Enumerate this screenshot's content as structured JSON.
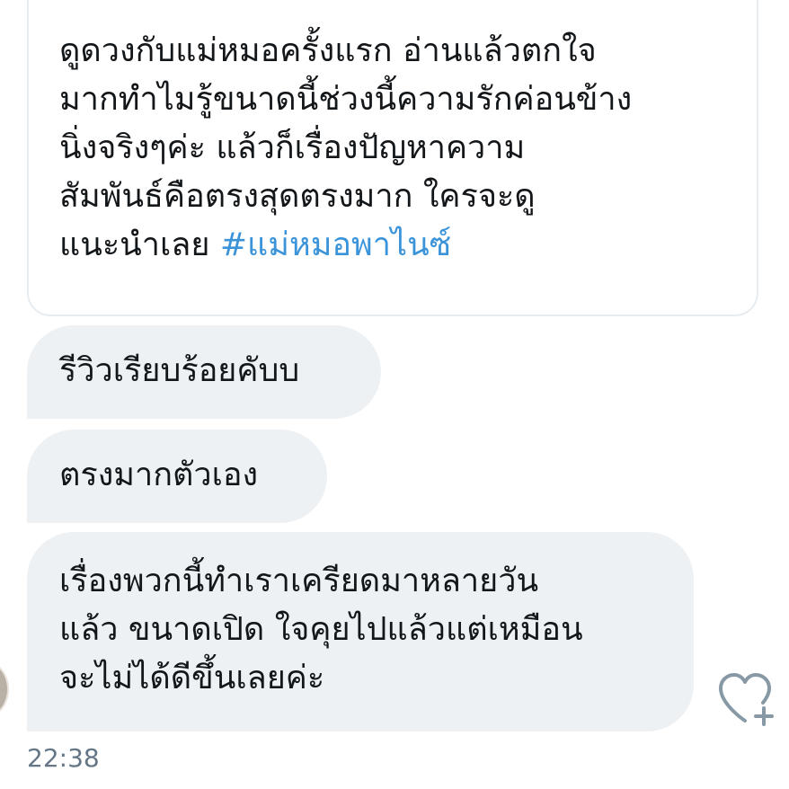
{
  "quoted_message": {
    "text": "ดูดวงกับแม่หมอครั้งแรก อ่านแล้วตกใจ\nมากทำไมรู้ขนาดนี้ช่วงนี้ความรักค่อนข้าง\nนิ่งจริงๆค่ะ แล้วก็เรื่องปัญหาความ\nสัมพันธ์คือตรงสุดตรงมาก ใครจะดู\nแนะนำเลย ",
    "hashtag": "#แม่หมอพาไนซ์"
  },
  "messages": [
    {
      "text": "รีวิวเรียบร้อยคับบ"
    },
    {
      "text": "ตรงมากตัวเอง"
    },
    {
      "text": "เรื่องพวกนี้ทำเราเครียดมาหลายวัน\nแล้ว ขนาดเปิด ใจคุยไปแล้วแต่เหมือน\nจะไม่ได้ดีขึ้นเลยค่ะ"
    }
  ],
  "timestamp": "22:38",
  "icons": {
    "like": "heart-plus-icon"
  },
  "colors": {
    "bubble_background": "#eef1f4",
    "hashtag": "#3b94d9",
    "timestamp": "#657786",
    "icon": "#8899a6"
  }
}
